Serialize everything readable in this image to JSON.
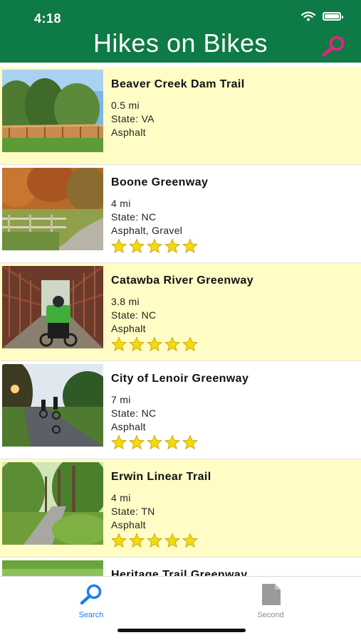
{
  "status": {
    "time": "4:18"
  },
  "header": {
    "title": "Hikes on Bikes",
    "search_icon": "search-icon"
  },
  "colors": {
    "header_bg": "#0e7a45",
    "row_highlight": "#fffcc5",
    "star": "#f5d90a",
    "search_icon": "#e0267a",
    "tab_active": "#1c7ef0",
    "tab_inactive": "#8e8e8e"
  },
  "trails": [
    {
      "name": "Beaver Creek Dam Trail",
      "distance": "0.5 mi",
      "state": "State: VA",
      "surface": "Asphalt",
      "stars": 0,
      "photo": "boardwalk-photo"
    },
    {
      "name": "Boone Greenway",
      "distance": "4 mi",
      "state": "State: NC",
      "surface": "Asphalt, Gravel",
      "stars": 5,
      "photo": "autumn-path-photo"
    },
    {
      "name": "Catawba River Greenway",
      "distance": "3.8 mi",
      "state": "State: NC",
      "surface": "Asphalt",
      "stars": 5,
      "photo": "bridge-cyclist-photo"
    },
    {
      "name": "City of Lenoir Greenway",
      "distance": "7 mi",
      "state": "State: NC",
      "surface": "Asphalt",
      "stars": 5,
      "photo": "sunset-path-photo"
    },
    {
      "name": "Erwin Linear Trail",
      "distance": "4 mi",
      "state": "State: TN",
      "surface": "Asphalt",
      "stars": 5,
      "photo": "forest-path-photo"
    },
    {
      "name": "Heritage Trail Greenway",
      "distance": "",
      "state": "",
      "surface": "",
      "stars": 0,
      "photo": "field-photo"
    }
  ],
  "tabbar": {
    "tabs": [
      {
        "label": "Search",
        "icon": "search-icon",
        "active": true
      },
      {
        "label": "Second",
        "icon": "document-icon",
        "active": false
      }
    ]
  }
}
